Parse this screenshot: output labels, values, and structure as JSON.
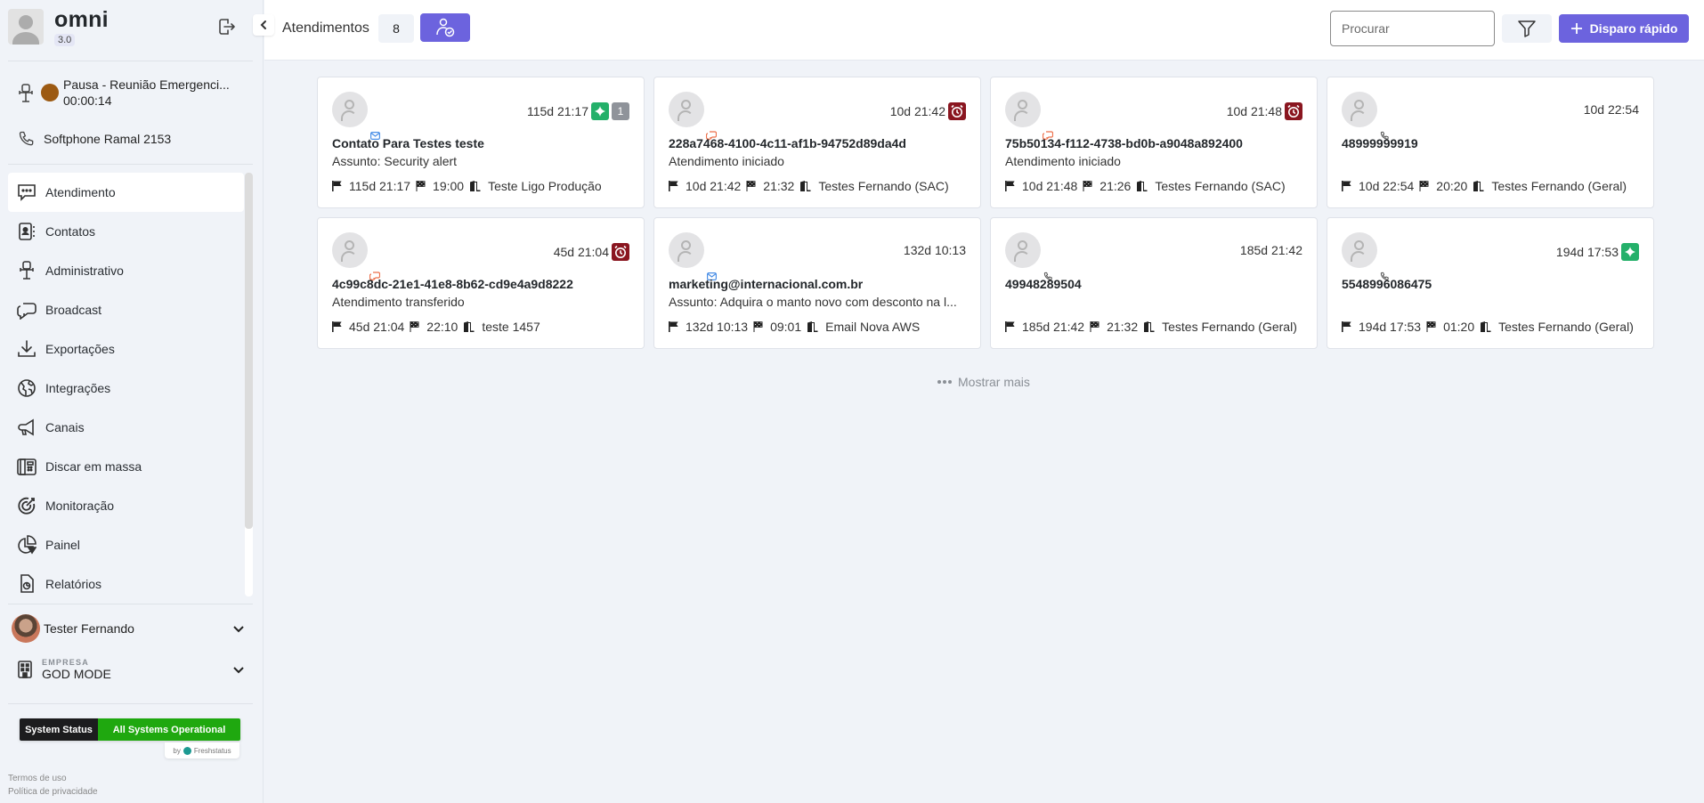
{
  "brand": {
    "name": "omni",
    "version": "3.0"
  },
  "agent_status": {
    "label": "Pausa - Reunião Emergenci...",
    "timer": "00:00:14",
    "color": "#9c5a13"
  },
  "softphone": {
    "label": "Softphone Ramal 2153"
  },
  "sidebar": {
    "items": [
      {
        "label": "Atendimento",
        "icon": "chat-dots-icon",
        "active": true
      },
      {
        "label": "Contatos",
        "icon": "contact-card-icon"
      },
      {
        "label": "Administrativo",
        "icon": "office-chair-icon"
      },
      {
        "label": "Broadcast",
        "icon": "chat-bubbles-icon"
      },
      {
        "label": "Exportações",
        "icon": "download-icon"
      },
      {
        "label": "Integrações",
        "icon": "globe-icon"
      },
      {
        "label": "Canais",
        "icon": "megaphone-icon"
      },
      {
        "label": "Discar em massa",
        "icon": "desk-phone-icon"
      },
      {
        "label": "Monitoração",
        "icon": "target-icon"
      },
      {
        "label": "Painel",
        "icon": "pie-chart-icon"
      },
      {
        "label": "Relatórios",
        "icon": "report-file-icon"
      }
    ]
  },
  "user": {
    "name": "Tester Fernando"
  },
  "company": {
    "caption": "EMPRESA",
    "name": "GOD MODE"
  },
  "system_status": {
    "left": "System Status",
    "right": "All Systems Operational",
    "by": "by",
    "provider": "Freshstatus"
  },
  "footer": {
    "terms": "Termos de uso",
    "privacy": "Política de privacidade"
  },
  "header": {
    "title": "Atendimentos",
    "count": "8",
    "search_placeholder": "Procurar",
    "quick_button": "Disparo rápido",
    "accent": "#6c63de"
  },
  "cards": [
    {
      "channel": "email",
      "time": "115d 21:17",
      "badges": [
        "sparkle",
        "count"
      ],
      "badge_count": "1",
      "name": "Contato Para Testes teste",
      "sub": "Assunto: Security alert",
      "started": "115d 21:17",
      "finished": "19:00",
      "queue": "Teste Ligo Produção"
    },
    {
      "channel": "chat",
      "time": "10d 21:42",
      "badges": [
        "alarm"
      ],
      "name": "228a7468-4100-4c11-af1b-94752d89da4d",
      "sub": "Atendimento iniciado",
      "started": "10d 21:42",
      "finished": "21:32",
      "queue": "Testes Fernando (SAC)"
    },
    {
      "channel": "chat",
      "time": "10d 21:48",
      "badges": [
        "alarm"
      ],
      "name": "75b50134-f112-4738-bd0b-a9048a892400",
      "sub": "Atendimento iniciado",
      "started": "10d 21:48",
      "finished": "21:26",
      "queue": "Testes Fernando (SAC)"
    },
    {
      "channel": "phone",
      "time": "10d 22:54",
      "badges": [],
      "name": "48999999919",
      "sub": "",
      "started": "10d 22:54",
      "finished": "20:20",
      "queue": "Testes Fernando (Geral)"
    },
    {
      "channel": "chat",
      "time": "45d 21:04",
      "badges": [
        "alarm"
      ],
      "name": "4c99c8dc-21e1-41e8-8b62-cd9e4a9d8222",
      "sub": "Atendimento transferido",
      "started": "45d 21:04",
      "finished": "22:10",
      "queue": "teste 1457"
    },
    {
      "channel": "email",
      "time": "132d 10:13",
      "badges": [],
      "name": "marketing@internacional.com.br",
      "sub": "Assunto: Adquira o manto novo com desconto na l...",
      "started": "132d 10:13",
      "finished": "09:01",
      "queue": "Email Nova AWS"
    },
    {
      "channel": "phone",
      "time": "185d 21:42",
      "badges": [],
      "name": "49948289504",
      "sub": "",
      "started": "185d 21:42",
      "finished": "21:32",
      "queue": "Testes Fernando (Geral)"
    },
    {
      "channel": "phone",
      "time": "194d 17:53",
      "badges": [
        "sparkle"
      ],
      "name": "5548996086475",
      "sub": "",
      "started": "194d 17:53",
      "finished": "01:20",
      "queue": "Testes Fernando (Geral)"
    }
  ],
  "show_more": "Mostrar mais",
  "colors": {
    "badge_green": "#24b06a",
    "badge_gray": "#8f939a",
    "badge_red": "#8a1620",
    "status_green": "#1fa80f"
  }
}
